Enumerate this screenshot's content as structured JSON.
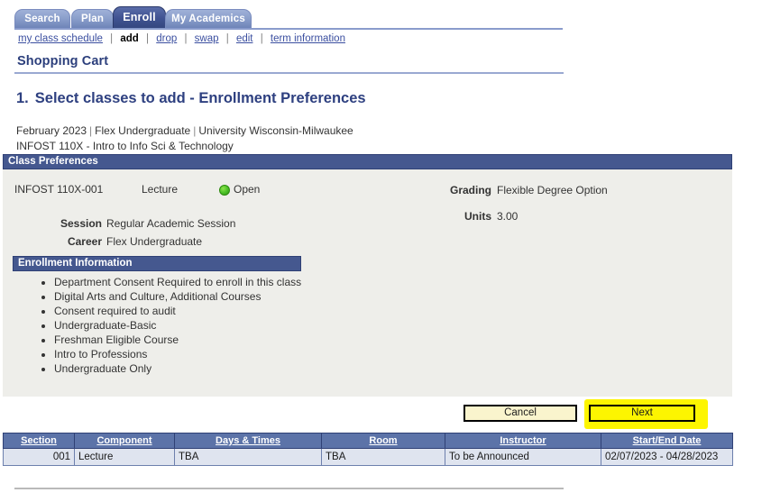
{
  "tabs": [
    {
      "label": "Search",
      "active": false
    },
    {
      "label": "Plan",
      "active": false
    },
    {
      "label": "Enroll",
      "active": true
    },
    {
      "label": "My Academics",
      "active": false
    }
  ],
  "subnav": {
    "items": [
      {
        "label": "my class schedule",
        "current": false
      },
      {
        "label": "add",
        "current": true
      },
      {
        "label": "drop",
        "current": false
      },
      {
        "label": "swap",
        "current": false
      },
      {
        "label": "edit",
        "current": false
      },
      {
        "label": "term information",
        "current": false
      }
    ],
    "separator": "|"
  },
  "page": {
    "title": "Shopping Cart",
    "step_number": "1.",
    "step_heading": "Select classes to add - Enrollment Preferences",
    "context_term": "February 2023",
    "context_career": "Flex Undergraduate",
    "context_institution": "University Wisconsin-Milwaukee",
    "context_separator": "|",
    "course_line": "INFOST  110X - Intro to Info Sci & Technology"
  },
  "class_preferences": {
    "section_bar_label": "Class Preferences",
    "class_code": "INFOST  110X-001",
    "component": "Lecture",
    "status": "Open",
    "status_color": "#4fc42a",
    "details": [
      {
        "label": "Session",
        "value": "Regular Academic Session"
      },
      {
        "label": "Career",
        "value": "Flex Undergraduate"
      }
    ],
    "right_details": [
      {
        "label": "Grading",
        "value": "Flexible Degree Option"
      },
      {
        "label": "Units",
        "value": "3.00"
      }
    ]
  },
  "enrollment_information": {
    "section_bar_label": "Enrollment Information",
    "items": [
      "Department Consent Required to enroll in this class",
      "Digital Arts and Culture, Additional Courses",
      "Consent required to audit",
      "Undergraduate-Basic",
      "Freshman Eligible Course",
      "Intro to Professions",
      "Undergraduate Only"
    ]
  },
  "actions": {
    "cancel_label": "Cancel",
    "next_label": "Next",
    "highlight_color": "#fdf500"
  },
  "class_table": {
    "headers": [
      "Section",
      "Component",
      "Days & Times",
      "Room",
      "Instructor",
      "Start/End Date"
    ],
    "rows": [
      {
        "section": "001",
        "component": "Lecture",
        "days_times": "TBA",
        "room": "TBA",
        "instructor": "To be Announced",
        "start_end_date": "02/07/2023 - 04/28/2023"
      }
    ]
  }
}
